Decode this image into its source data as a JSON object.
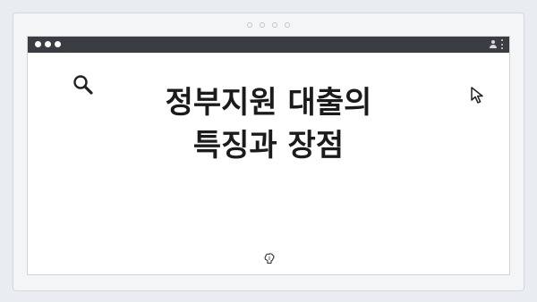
{
  "window": {
    "title_lines": [
      "정부지원 대출의",
      "특징과 장점"
    ]
  },
  "icons": {
    "search": "search-icon",
    "cursor": "cursor-icon",
    "idea": "brain-icon",
    "user": "user-icon",
    "menu": "kebab-menu-icon"
  },
  "colors": {
    "titlebar": "#3a3d42",
    "page_background": "#e9edf1",
    "text": "#1b1b1b"
  }
}
